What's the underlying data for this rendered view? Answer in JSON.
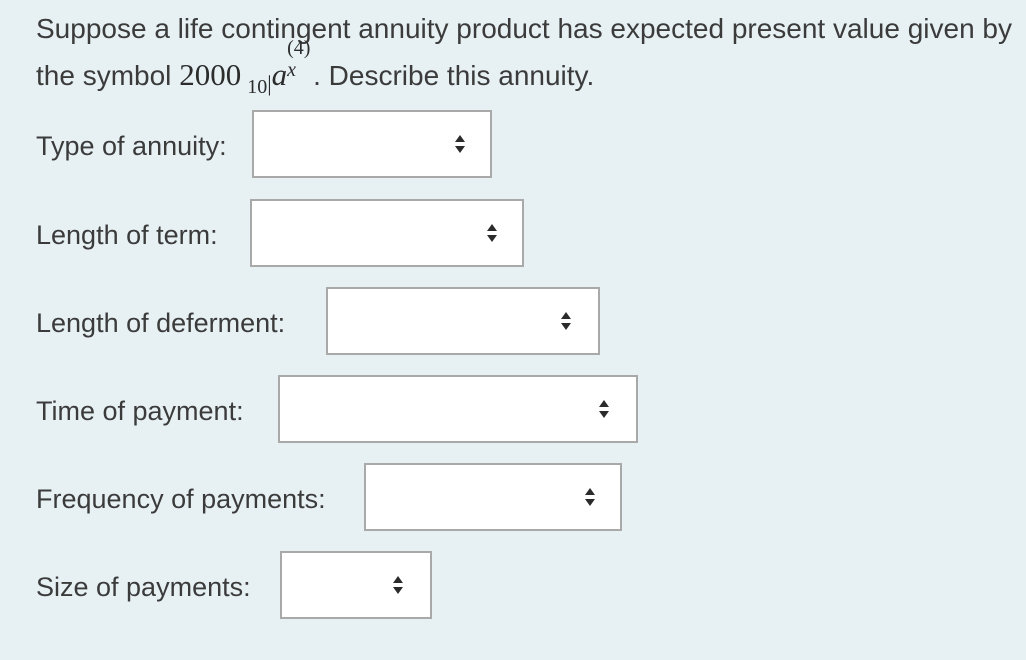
{
  "question": {
    "before_math": "Suppose a life contingent annuity product has expected present value given by the symbol",
    "math_coef": "2000",
    "math_deferral": "10",
    "math_bar": "|",
    "math_symbol": "a",
    "math_superscript": "(4)",
    "math_subscript": "x",
    "after_math": ". Describe this annuity."
  },
  "fields": [
    {
      "label": "Type of annuity:",
      "value": ""
    },
    {
      "label": "Length of term:",
      "value": ""
    },
    {
      "label": "Length of deferment:",
      "value": ""
    },
    {
      "label": "Time of payment:",
      "value": ""
    },
    {
      "label": "Frequency of payments:",
      "value": ""
    },
    {
      "label": "Size of payments:",
      "value": ""
    }
  ],
  "icons": {
    "dropdown_arrow": "up-down-arrows-icon"
  },
  "colors": {
    "background": "#e7f1f4",
    "select_border": "#a9a9a9",
    "select_bg": "#ffffff",
    "text": "#3b3b3b"
  }
}
